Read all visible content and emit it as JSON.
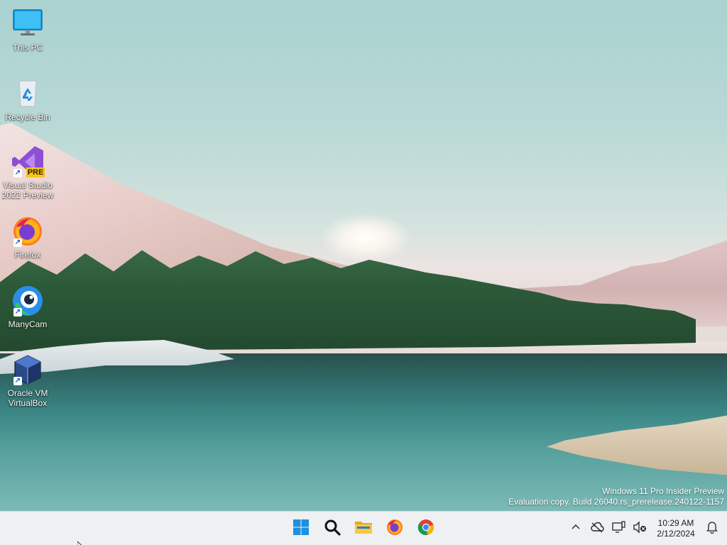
{
  "desktop": {
    "icons": [
      {
        "label": "This PC"
      },
      {
        "label": "Recycle Bin"
      },
      {
        "label": "Visual Studio 2022 Preview",
        "badge": "PRE"
      },
      {
        "label": "Firefox"
      },
      {
        "label": "ManyCam"
      },
      {
        "label": "Oracle VM VirtualBox"
      }
    ],
    "watermark": {
      "line1": "Windows 11 Pro Insider Preview",
      "line2": "Evaluation copy. Build 26040.rs_prerelease.240122-1157"
    }
  },
  "taskbar": {
    "pinned": [
      {
        "name": "start",
        "icon": "windows-logo-icon"
      },
      {
        "name": "search",
        "icon": "search-icon"
      },
      {
        "name": "file-explorer",
        "icon": "folder-icon"
      },
      {
        "name": "firefox",
        "icon": "firefox-icon"
      },
      {
        "name": "chrome",
        "icon": "chrome-icon"
      }
    ],
    "tray": {
      "icons": [
        "chevron-up-icon",
        "onedrive-offline-icon",
        "network-icon",
        "volume-muted-icon"
      ],
      "time": "10:29 AM",
      "date": "2/12/2024",
      "notification_icon": "bell-icon"
    },
    "accent": "#1e90e0"
  }
}
